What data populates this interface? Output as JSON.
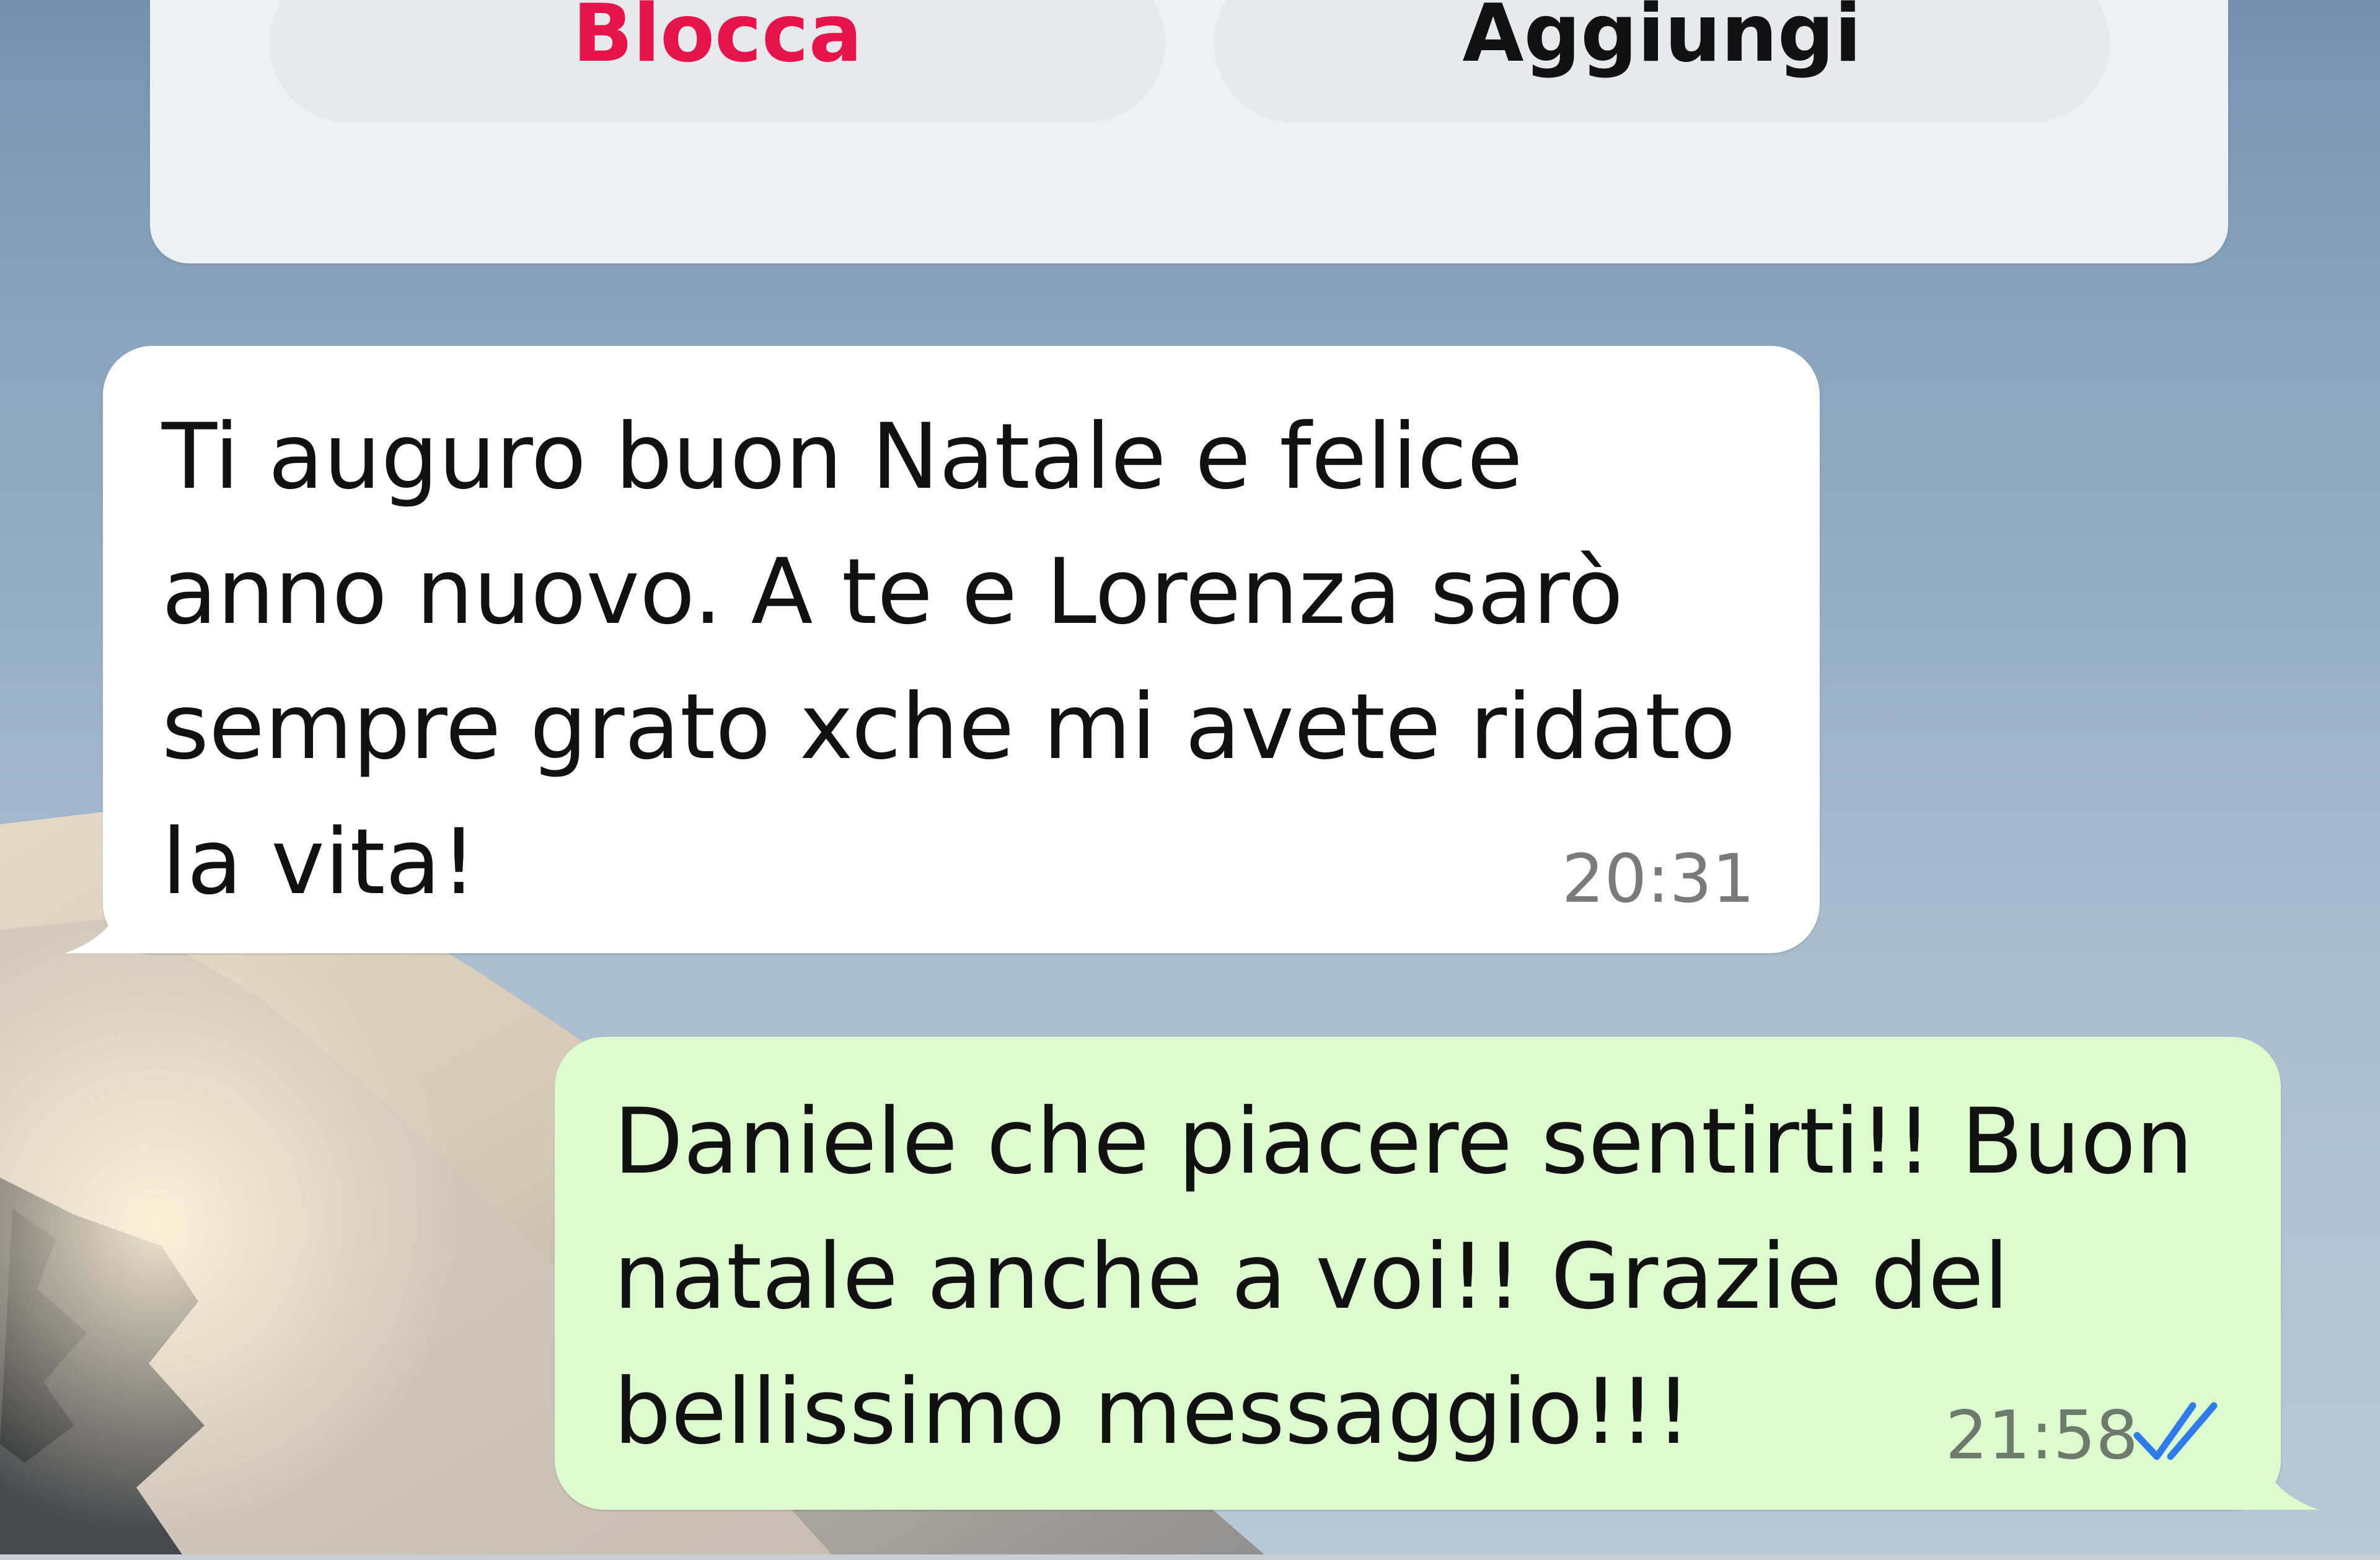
{
  "contact_actions": {
    "block_label": "Blocca",
    "add_label": "Aggiungi"
  },
  "messages": [
    {
      "direction": "incoming",
      "lines": [
        "Ti auguro buon Natale e felice",
        "anno nuovo. A te e Lorenza sarò",
        "sempre grato xche mi avete ridato",
        "la vita!"
      ],
      "time": "20:31"
    },
    {
      "direction": "outgoing",
      "lines": [
        "Daniele che piacere sentirti!! Buon",
        "natale anche a voi!! Grazie del",
        "bellissimo messaggio!!!"
      ],
      "time": "21:58",
      "status_icon": "double-check-read-icon"
    }
  ],
  "colors": {
    "block_red": "#e5144a",
    "incoming_bubble": "#ffffff",
    "outgoing_bubble": "#dcfccf",
    "read_tick_blue": "#2f7bea"
  }
}
